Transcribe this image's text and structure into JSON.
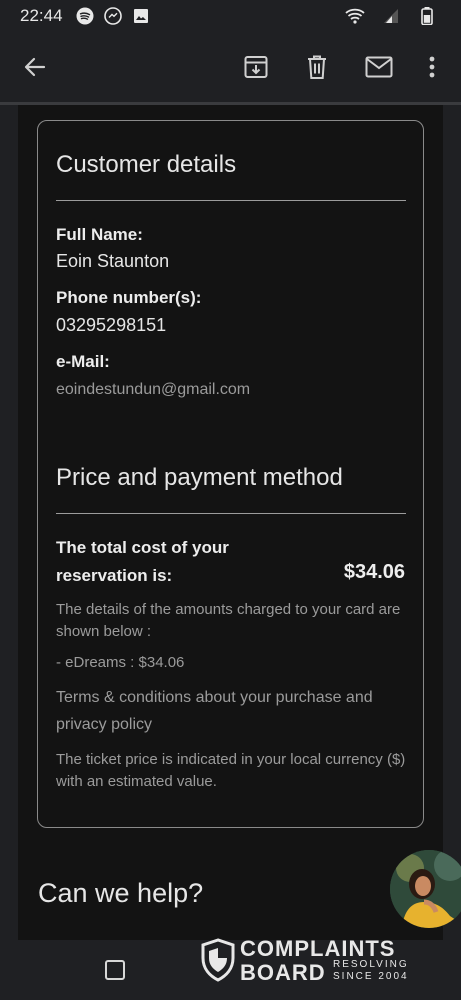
{
  "status_bar": {
    "time": "22:44"
  },
  "customer": {
    "title": "Customer details",
    "full_name_label": "Full Name:",
    "full_name": "Eoin Staunton",
    "phone_label": "Phone number(s):",
    "phone": "03295298151",
    "email_label": "e-Mail:",
    "email": "eoindestundun@gmail.com"
  },
  "payment": {
    "title": "Price and payment method",
    "total_label": "The total cost of your reservation is:",
    "total_value": "$34.06",
    "details_text": "The details of the amounts charged to your card are shown below :",
    "line_item": "- eDreams : $34.06",
    "terms_text": "Terms & conditions about your purchase and privacy policy",
    "currency_note": "The ticket price is indicated in your local currency ($) with an estimated value."
  },
  "help": {
    "title": "Can we help?"
  },
  "watermark": {
    "line1": "COMPLAINTS",
    "line2": "BOARD",
    "sub1": "RESOLVING",
    "sub2": "SINCE 2004"
  },
  "colors": {
    "background": "#1f2023",
    "card": "#131313",
    "border": "#8a8a8a"
  },
  "icons": [
    "spotify-icon",
    "messenger-icon",
    "image-icon",
    "wifi-icon",
    "signal-icon",
    "battery-icon",
    "back-arrow-icon",
    "archive-icon",
    "delete-icon",
    "mail-icon",
    "more-vert-icon"
  ]
}
